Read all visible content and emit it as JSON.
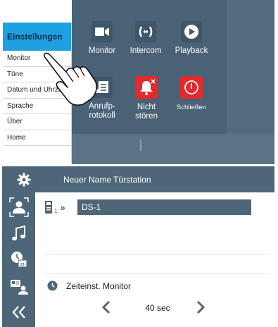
{
  "top_screen": {
    "settings_menu": {
      "title": "Einstellungen",
      "items": [
        "Monitor",
        "Töne",
        "Datum und Uhrzeit",
        "Sprache",
        "Über",
        "Home"
      ]
    },
    "tiles": [
      {
        "label": "Monitor",
        "icon": "video-camera-icon"
      },
      {
        "label": "Intercom",
        "icon": "intercom-icon"
      },
      {
        "label": "Playback",
        "icon": "play-icon"
      },
      {
        "label": "Anrufp-\nrotokoll",
        "icon": "call-log-icon"
      },
      {
        "label": "Nicht\nstören",
        "icon": "do-not-disturb-icon"
      },
      {
        "label": "Schließen",
        "icon": "power-icon"
      }
    ],
    "colors": {
      "accent": "#1fa0e0",
      "panel": "#4a6275",
      "alert": "#e52a2e"
    }
  },
  "bottom_screen": {
    "header_title": "Neuer Name Türstation",
    "device": {
      "index": "1",
      "name": "DS-1"
    },
    "timer_label": "Zeiteinst. Monitor",
    "timer_value": "40 sec",
    "sidebar_icons": [
      "gear-icon",
      "user-icon",
      "music-note-icon",
      "calendar-clock-icon",
      "contacts-icon",
      "collapse-icon"
    ]
  }
}
